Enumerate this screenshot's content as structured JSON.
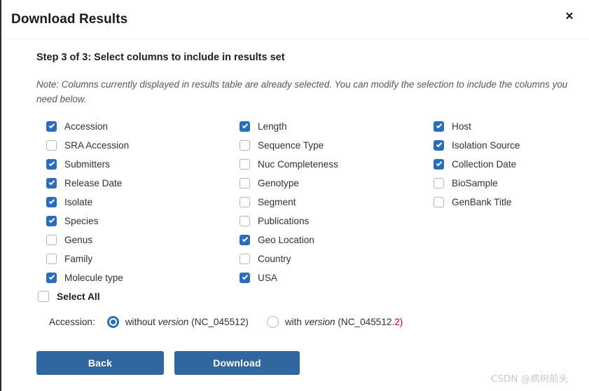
{
  "dialog": {
    "title": "Download Results",
    "close_label": "✕",
    "step_heading": "Step 3 of 3: Select columns to include in results set",
    "note": "Note: Columns currently displayed in results table are already selected. You can modify the selection to include the columns you need below."
  },
  "accent_color": "#2a6ebb",
  "button_color": "#30679e",
  "version_highlight_color": "#d0021b",
  "columns": [
    {
      "items": [
        {
          "label": "Accession",
          "checked": true
        },
        {
          "label": "SRA Accession",
          "checked": false
        },
        {
          "label": "Submitters",
          "checked": true
        },
        {
          "label": "Release Date",
          "checked": true
        },
        {
          "label": "Isolate",
          "checked": true
        },
        {
          "label": "Species",
          "checked": true
        },
        {
          "label": "Genus",
          "checked": false
        },
        {
          "label": "Family",
          "checked": false
        },
        {
          "label": "Molecule type",
          "checked": true
        }
      ]
    },
    {
      "items": [
        {
          "label": "Length",
          "checked": true
        },
        {
          "label": "Sequence Type",
          "checked": false
        },
        {
          "label": "Nuc Completeness",
          "checked": false
        },
        {
          "label": "Genotype",
          "checked": false
        },
        {
          "label": "Segment",
          "checked": false
        },
        {
          "label": "Publications",
          "checked": false
        },
        {
          "label": "Geo Location",
          "checked": true
        },
        {
          "label": "Country",
          "checked": false
        },
        {
          "label": "USA",
          "checked": true
        }
      ]
    },
    {
      "items": [
        {
          "label": "Host",
          "checked": true
        },
        {
          "label": "Isolation Source",
          "checked": true
        },
        {
          "label": "Collection Date",
          "checked": true
        },
        {
          "label": "BioSample",
          "checked": false
        },
        {
          "label": "GenBank Title",
          "checked": false
        }
      ]
    }
  ],
  "select_all": {
    "label": "Select All",
    "checked": false
  },
  "accession_option": {
    "label": "Accession:",
    "options": [
      {
        "prefix": "without ",
        "emphasis": "version",
        "suffix": " (NC_045512)",
        "version_suffix": "",
        "selected": true
      },
      {
        "prefix": "with ",
        "emphasis": "version",
        "suffix": " (NC_045512.",
        "version_suffix": "2)",
        "selected": false
      }
    ]
  },
  "footer": {
    "back_label": "Back",
    "download_label": "Download"
  },
  "watermark": "CSDN @病树前头"
}
